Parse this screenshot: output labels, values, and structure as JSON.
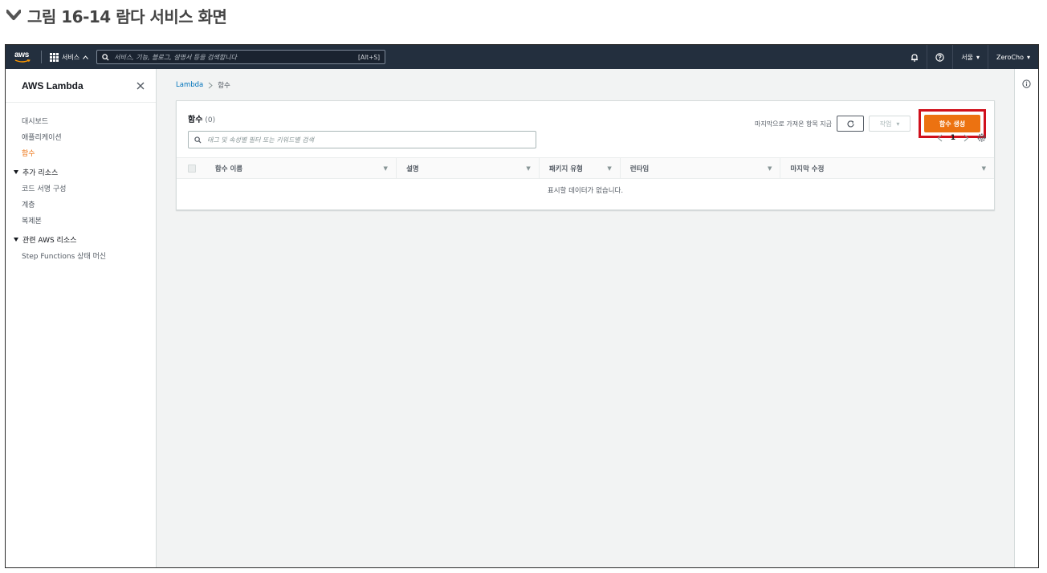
{
  "caption": "그림 16-14 람다 서비스 화면",
  "topnav": {
    "logo": "aws",
    "services_label": "서비스",
    "search_placeholder": "서비스, 기능, 블로그, 설명서 등을 검색합니다",
    "search_shortcut": "[Alt+S]",
    "region_label": "서울",
    "account_label": "ZeroCho"
  },
  "sidebar": {
    "title": "AWS Lambda",
    "items": [
      {
        "label": "대시보드",
        "active": false
      },
      {
        "label": "애플리케이션",
        "active": false
      },
      {
        "label": "함수",
        "active": true
      }
    ],
    "sections": [
      {
        "title": "추가 리소스",
        "items": [
          "코드 서명 구성",
          "계층",
          "복제본"
        ]
      },
      {
        "title": "관련 AWS 리소스",
        "items": [
          "Step Functions 상태 머신"
        ]
      }
    ]
  },
  "breadcrumb": {
    "root": "Lambda",
    "current": "함수"
  },
  "panel": {
    "title": "함수",
    "count": "(0)",
    "status_text": "마지막으로 가져온 항목 지금",
    "actions_label": "작업",
    "create_button": "함수 생성",
    "search_placeholder": "태그 및 속성별 필터 또는 키워드별 검색",
    "page_number": "1",
    "columns": [
      "함수 이름",
      "설명",
      "패키지 유형",
      "런타임",
      "마지막 수정"
    ],
    "empty_text": "표시할 데이터가 없습니다."
  },
  "colors": {
    "nav_bg": "#232f3e",
    "accent_orange": "#ec7211",
    "highlight_red": "#d0101c",
    "link_blue": "#0073bb"
  }
}
